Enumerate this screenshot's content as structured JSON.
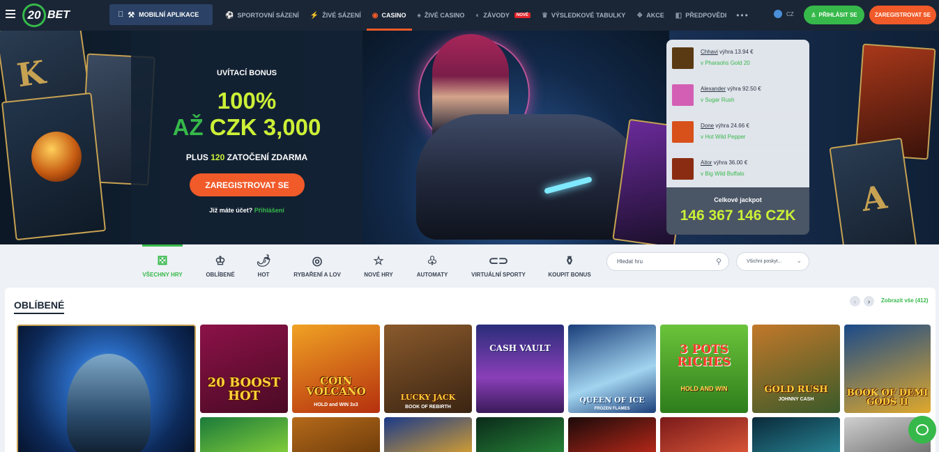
{
  "header": {
    "logo_number": "20",
    "logo_text": "BET",
    "app_button": "MOBILNÍ APLIKACE",
    "nav": [
      {
        "label": "SPORTOVNÍ SÁZENÍ",
        "icon": "soccer-ball-icon"
      },
      {
        "label": "ŽIVÉ SÁZENÍ",
        "icon": "live-icon"
      },
      {
        "label": "CASINO",
        "icon": "casino-chip-icon"
      },
      {
        "label": "ŽIVÉ CASINO",
        "icon": "live-casino-icon"
      },
      {
        "label": "ZÁVODY",
        "icon": "races-icon",
        "badge": "NOVÉ"
      },
      {
        "label": "VÝSLEDKOVÉ TABULKY",
        "icon": "trophy-icon"
      },
      {
        "label": "AKCE",
        "icon": "gift-icon"
      },
      {
        "label": "PŘEDPOVĚDI",
        "icon": "predictions-icon"
      }
    ],
    "active_nav": "CASINO",
    "more": "•••",
    "language": "CZ",
    "login_button": "PŘIHLÁSIT SE",
    "register_button": "ZAREGISTROVAT SE"
  },
  "hero": {
    "bonus_label": "UVÍTACÍ BONUS",
    "bonus_percent": "100%",
    "bonus_up_to": "AŽ",
    "bonus_amount": "CZK 3,000",
    "spins_prefix": "PLUS",
    "spins_count": "120",
    "spins_suffix": "ZATOČENÍ ZDARMA",
    "cta": "ZAREGISTROVAT SE",
    "account_question": "Již máte účet?",
    "account_link": "Přihlášení",
    "recent_wins": [
      {
        "prefix": "",
        "user": "Chhavi",
        "text": " výhra 13.94 €",
        "game": "v Pharaohs Gold 20",
        "thumb_color": "#5a3a12"
      },
      {
        "prefix": "",
        "user": "Alexander",
        "text": " výhra 92.50 €",
        "game": "v Sugar Rush",
        "thumb_color": "#d35fb4"
      },
      {
        "prefix": "",
        "user": "Done",
        "text": " výhra 24.66 €",
        "game": "v Hot Wild Pepper",
        "thumb_color": "#d8501a"
      },
      {
        "prefix": "",
        "user": "Aitor",
        "text": " výhra 36.00 €",
        "game": "v Big Wild Buffalo",
        "thumb_color": "#8a2c12"
      }
    ],
    "jackpot_label": "Celkové jackpot",
    "jackpot_value": "146 367 146 CZK"
  },
  "categories": [
    {
      "label": "VŠECHNY HRY",
      "icon": "dice-icon",
      "glyph": "⚄"
    },
    {
      "label": "OBLÍBENÉ",
      "icon": "crown-icon",
      "glyph": "♔"
    },
    {
      "label": "HOT",
      "icon": "chili-icon",
      "glyph": "🌶"
    },
    {
      "label": "RYBAŘENÍ A LOV",
      "icon": "target-icon",
      "glyph": "◎"
    },
    {
      "label": "NOVÉ HRY",
      "icon": "star-icon",
      "glyph": "☆"
    },
    {
      "label": "AUTOMATY",
      "icon": "cherry-icon",
      "glyph": "♧"
    },
    {
      "label": "VIRTUÁLNÍ SPORTY",
      "icon": "vr-headset-icon",
      "glyph": "⊂⊃"
    },
    {
      "label": "KOUPIT BONUS",
      "icon": "money-bag-icon",
      "glyph": "⚱"
    }
  ],
  "search": {
    "placeholder": "Hledat hru"
  },
  "provider_select": {
    "value": "Všichni poskyt..."
  },
  "section": {
    "title": "OBLÍBENÉ",
    "show_all": "Zobrazit vše (412)",
    "prev": "‹",
    "next": "›"
  },
  "games": [
    {
      "name": "",
      "sub": "",
      "colors": [
        "#0d2a5a",
        "#3a7fc8"
      ]
    },
    {
      "name": "20 BOOST HOT",
      "sub": "",
      "colors": [
        "#8c1248",
        "#4a0a24"
      ]
    },
    {
      "name": "COIN VOLCANO",
      "sub": "HOLD and WIN 3x3",
      "colors": [
        "#f0a224",
        "#b5300e"
      ]
    },
    {
      "name": "LUCKY JACK",
      "sub": "BOOK OF REBIRTH",
      "colors": [
        "#8a5a2c",
        "#3a2412"
      ]
    },
    {
      "name": "CASH VAULT",
      "sub": "",
      "colors": [
        "#2a2d7a",
        "#8a3fb8"
      ]
    },
    {
      "name": "QUEEN OF ICE",
      "sub": "FROZEN FLAMES",
      "colors": [
        "#1a3e7a",
        "#a2d4ef"
      ]
    },
    {
      "name": "3 POTS RICHES",
      "sub": "HOLD AND WIN",
      "colors": [
        "#6bc43a",
        "#2e7d1c"
      ]
    },
    {
      "name": "GOLD RUSH",
      "sub": "JOHNNY CASH",
      "colors": [
        "#c2782a",
        "#3a5a2a"
      ]
    },
    {
      "name": "BOOK OF DEMI GODS II",
      "sub": "",
      "colors": [
        "#1a4a8a",
        "#e0a92c"
      ]
    }
  ],
  "games_row2": [
    {
      "colors": [
        "#1a7a3a",
        "#8ad43a"
      ]
    },
    {
      "colors": [
        "#b56a1a",
        "#6a3a0a"
      ]
    },
    {
      "colors": [
        "#1a3a8a",
        "#e0a52c"
      ]
    },
    {
      "colors": [
        "#0a2a1a",
        "#2a8a3a"
      ]
    },
    {
      "colors": [
        "#1a0a0a",
        "#c22a1a"
      ]
    },
    {
      "colors": [
        "#7a1a1a",
        "#e05a3a"
      ]
    },
    {
      "colors": [
        "#0a2a3a",
        "#2a8a9a"
      ]
    },
    {
      "colors": [
        "#d0d0d0",
        "#6a6a6a"
      ]
    }
  ],
  "accent": "#36b94a",
  "cta_color": "#f15a29"
}
